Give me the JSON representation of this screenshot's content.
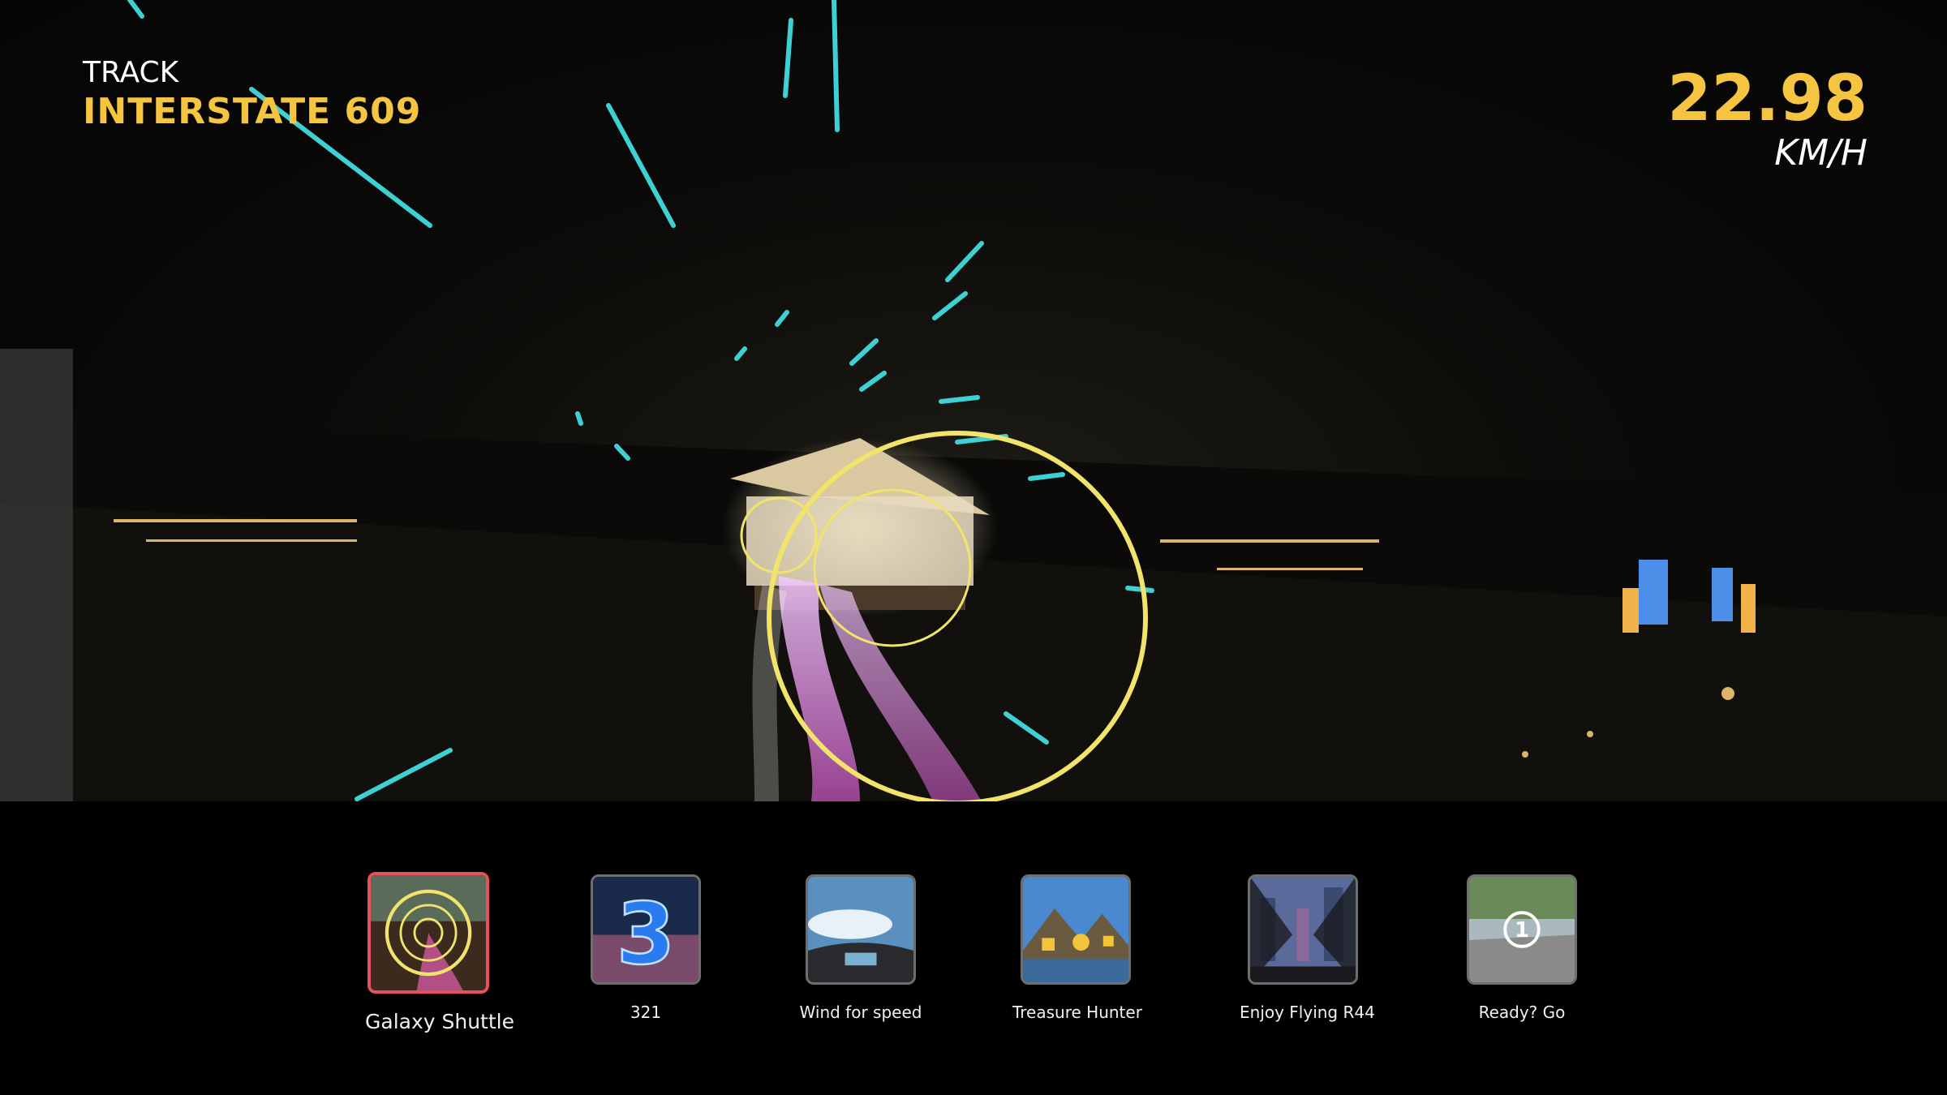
{
  "hud": {
    "track_label": "TRACK",
    "track_name": "INTERSTATE 609",
    "speed_value": "22.98",
    "speed_unit": "KM/H"
  },
  "carousel": {
    "selected_index": 0,
    "items": [
      {
        "title": "Galaxy Shuttle",
        "icon": "galaxy-shuttle-thumb"
      },
      {
        "title": "321",
        "icon": "countdown-3-thumb"
      },
      {
        "title": "Wind for speed",
        "icon": "cockpit-thumb"
      },
      {
        "title": "Treasure Hunter",
        "icon": "treasure-coins-thumb"
      },
      {
        "title": "Enjoy Flying R44",
        "icon": "helicopter-city-thumb"
      },
      {
        "title": "Ready? Go",
        "icon": "countdown-1-road-thumb"
      }
    ]
  },
  "colors": {
    "accent_yellow": "#f5c542",
    "streak_cyan": "#3fd0d4",
    "selected_border": "#e8505b"
  }
}
